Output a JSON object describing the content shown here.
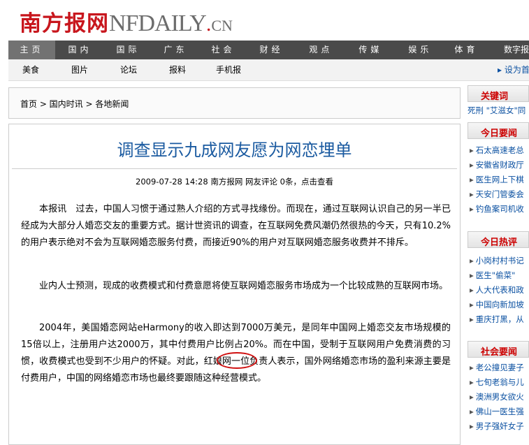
{
  "logo": {
    "cn": "南方报网",
    "en": "NFDAILY",
    "dot": ".",
    "suffix": "CN"
  },
  "nav": {
    "primary": [
      "主页",
      "国内",
      "国际",
      "广东",
      "社会",
      "财经",
      "观点",
      "传媒",
      "娱乐",
      "体育",
      "数字报"
    ],
    "secondary": [
      "美食",
      "图片",
      "论坛",
      "报料",
      "手机报"
    ],
    "sethome": "▸ 设为首页"
  },
  "breadcrumb": {
    "text": "首页  >  国内时讯  >  各地新闻"
  },
  "article": {
    "title": "调查显示九成网友愿为网恋埋单",
    "meta": "2009-07-28 14:28  南方报网  网友评论 0条，点击查看",
    "paragraphs": [
      "本报讯　过去，中国人习惯于通过熟人介绍的方式寻找缘份。而现在，通过互联网认识自己的另一半已经成为大部分人婚恋交友的重要方式。据计世资讯的调查，在互联网免费风潮仍然很热的今天，只有10.2%的用户表示绝对不会为互联网婚恋服务付费，而接近90%的用户对互联网婚恋服务收费并不排斥。",
      "业内人士预测，现成的收费模式和付费意愿将使互联网婚恋服务市场成为一个比较成熟的互联网市场。",
      "2004年，美国婚恋网站eHarmony的收入即达到7000万美元，是同年中国网上婚恋交友市场规模的15倍以上，注册用户达2000万，其中付费用户比例占20%。而在中国，受制于互联网用户免费消费的习惯，收费模式也受到不少用户的怀疑。对此，红娘网一位负责人表示，国外网络婚恋市场的盈利来源主要是付费用户，中国的网络婚恋市场也最终要跟随这种经营模式。"
    ]
  },
  "sidebar": {
    "keywords_title": "关键词",
    "keywords_text": "死刑  \"艾滋女\"同",
    "today_title": "今日要闻",
    "today": [
      "石太高速老总",
      "安徽省财政厅",
      "医生网上下棋",
      "天安门管委会",
      "钓鱼案司机收"
    ],
    "hot_title": "今日热评",
    "hot": [
      "小岗村村书记",
      "医生\"偷菜\"",
      "人大代表和政",
      "中国向新加坡",
      "重庆打黑，从"
    ],
    "social_title": "社会要闻",
    "social": [
      "老公撞见妻子",
      "七旬老翁与儿",
      "澳洲男女欲火",
      "佛山一医生强",
      "男子强奸女子"
    ]
  },
  "colors": {
    "brand_red": "#c8161d",
    "link_blue": "#0a50a1",
    "nav_dark": "#4a4a4a",
    "nav_active": "#727272",
    "title_blue": "#1a5aa0"
  }
}
